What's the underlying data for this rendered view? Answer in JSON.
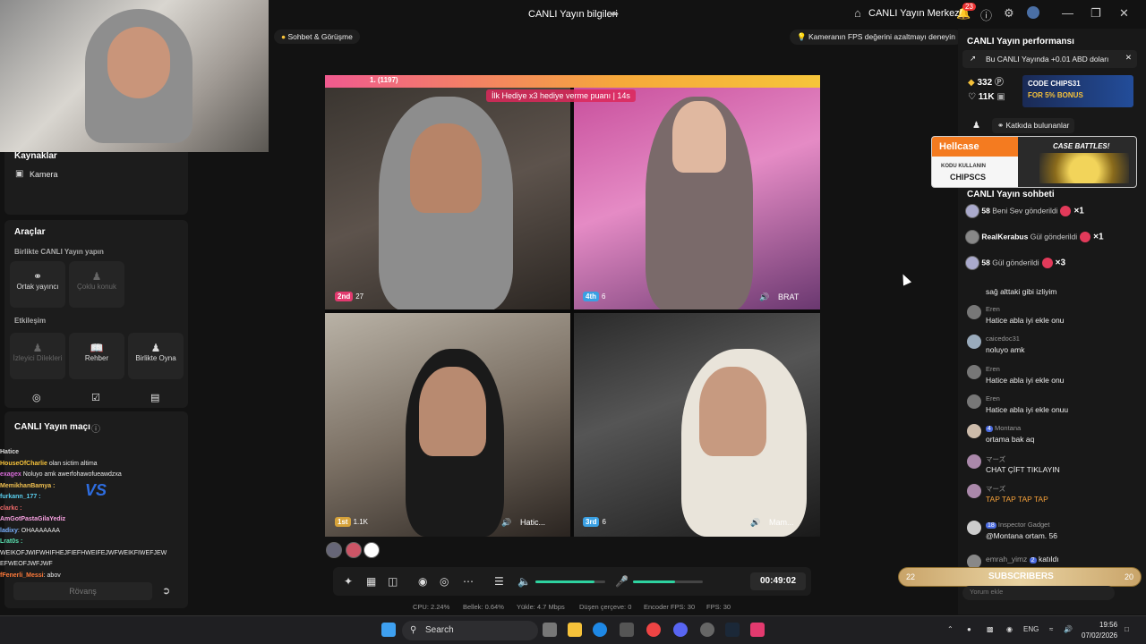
{
  "header": {
    "title": "CANLI Yayın bilgileri",
    "live_center": "CANLI Yayın Merkezi",
    "notif_count": "23"
  },
  "left": {
    "sources_title": "Kaynaklar",
    "camera_label": "Kamera",
    "tools_title": "Araçlar",
    "together_title": "Birlikte CANLI Yayın yapın",
    "cohost": "Ortak yayıncı",
    "multi_guest": "Çoklu konuk",
    "interaction_title": "Etkileşim",
    "viewer_requests": "İzleyici Dilekleri",
    "guide": "Rehber",
    "play_together": "Birlikte Oyna",
    "match_title": "CANLI Yayın maçı",
    "rematch": "Rövanş"
  },
  "overlay_chat": [
    {
      "user": "Hatice",
      "msg": ""
    },
    {
      "user": "HouseOfCharlie",
      "msg": "olan sictim altima"
    },
    {
      "user": "exagex",
      "msg": "Noluyo amk awerfohawofueawdzxa"
    },
    {
      "user": "MemikhanBamya :",
      "msg": ""
    },
    {
      "user": "furkann_177 :",
      "msg": ""
    },
    {
      "user": "clarkc :",
      "msg": ""
    },
    {
      "user": "AmGotPastaGilaYediz",
      "msg": ""
    },
    {
      "user": "ladixy",
      "msg": ": OHAAAAAAA"
    },
    {
      "user": "Lrat0s :",
      "msg": ""
    },
    {
      "user": "",
      "msg": "WEIKOFJWIFWHIFHEJFIEFHWEIFEJWFWEIKFIWEFJEW"
    },
    {
      "user": "",
      "msg": "EFWEOFJWFJWF"
    },
    {
      "user": "fFenerli_Messi",
      "msg": ": abov"
    }
  ],
  "pills": {
    "chat_call": "Sohbet & Görüşme",
    "fps_tip": "Kameranın FPS değerini azaltmayı deneyin"
  },
  "stream": {
    "top_rank": "1. (1197)",
    "gift_banner": "İlk Hediye x3 hediye verme puanı",
    "gift_timer": "14s",
    "tiles": [
      {
        "rank": "2nd",
        "score": "27",
        "name": ""
      },
      {
        "rank": "4th",
        "score": "6",
        "name": "BRAT"
      },
      {
        "rank": "1st",
        "score": "1.1K",
        "name": "Hatic..."
      },
      {
        "rank": "3rd",
        "score": "6",
        "name": "Mam..."
      }
    ]
  },
  "controls": {
    "timer": "00:49:02",
    "mic_level": 0.6,
    "vol_level": 0.85
  },
  "stats": {
    "cpu": "CPU: 2.24%",
    "mem": "Bellek: 0.64%",
    "upload": "Yükle: 4.7 Mbps",
    "dropped": "Düşen çerçeve: 0",
    "enc_fps": "Encoder FPS: 30",
    "fps": "FPS: 30"
  },
  "right": {
    "perf_title": "CANLI Yayın performansı",
    "earn": "Bu CANLI Yayında +0.01 ABD doları",
    "diamonds": "332",
    "likes": "11K",
    "ad1_code": "CODE CHIPS31",
    "ad1_bonus": "FOR 5% BONUS",
    "contributors": "Katkıda bulunanlar",
    "ad2_brand": "Hellcase",
    "ad2_sub": "KODU KULLANIN",
    "ad2_code": "CHIPSCS",
    "ad2_title": "CASE BATTLES!",
    "chat_title": "CANLI Yayın sohbeti",
    "gifts": [
      {
        "user": "58",
        "action": "Beni Sev gönderildi",
        "count": "×1"
      },
      {
        "user": "RealKerabus",
        "action": "Gül gönderildi",
        "count": "×1"
      },
      {
        "user": "58",
        "action": "Gül gönderildi",
        "count": "×3"
      }
    ],
    "first_msg": "sağ alttaki gibi izliyim",
    "messages": [
      {
        "user": "Eren",
        "level": "",
        "text": "Hatice abla iyi ekle onu"
      },
      {
        "user": "caicedoc31",
        "level": "",
        "text": "noluyo amk"
      },
      {
        "user": "Eren",
        "level": "",
        "text": "Hatice abla iyi ekle onu"
      },
      {
        "user": "Eren",
        "level": "",
        "text": "Hatice abla iyi ekle onuu"
      },
      {
        "user": "Montana",
        "level": "4",
        "text": "ortama bak aq"
      },
      {
        "user": "マーズ",
        "level": "",
        "text": "CHAT ÇİFT TIKLAYIN"
      },
      {
        "user": "マーズ",
        "level": "",
        "text": "TAP TAP TAP TAP"
      },
      {
        "user": "Inspector Gadget",
        "level": "18",
        "text": "@Montana ortam. 56"
      },
      {
        "user": "emrah_yimz",
        "level": "2",
        "text": "katıldı"
      }
    ],
    "sub_left": "22",
    "sub_label": "SUBSCRIBERS",
    "sub_right": "20",
    "comment_placeholder": "Yorum ekle"
  },
  "taskbar": {
    "search": "Search",
    "lang": "ENG",
    "time": "19:56",
    "date": "07/02/2026"
  }
}
